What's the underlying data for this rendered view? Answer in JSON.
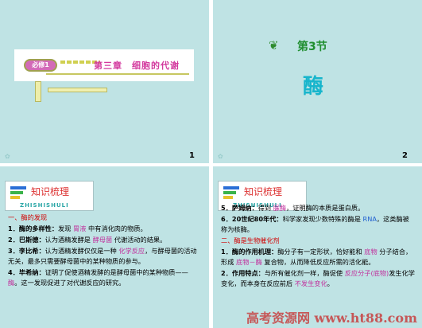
{
  "slide1": {
    "badge": "必修1",
    "chapter_title": "第三章　细胞的代谢",
    "page_number": "1"
  },
  "slide2": {
    "section_label": "第3节",
    "title": "酶",
    "page_number": "2"
  },
  "slide3": {
    "header": {
      "title": "知识梳理",
      "pinyin": "ZHISHISHULI"
    },
    "heading1": "一、酶的发现",
    "items": [
      {
        "lead": "1．酶的多样性：",
        "text": "发现",
        "hl": "胃液",
        "tail": "中有消化肉的物质。"
      },
      {
        "lead": "2．巴斯德：",
        "text": "认为酒精发酵是",
        "hl": "酵母菌",
        "tail": "代谢活动的结果。"
      },
      {
        "lead": "3．李比希：",
        "text": "认为酒精发酵仅仅是一种",
        "hl": "化学反应",
        "tail": "，与酵母菌的活动无关，最多只需要酵母菌中的某种物质的参与。"
      },
      {
        "lead": "4．毕希纳：",
        "text": "证明了促使酒精发酵的是酵母菌中的某种物质——",
        "hl": "酶",
        "tail": "。这一发现促进了对代谢反应的研究。"
      }
    ]
  },
  "slide4": {
    "header": {
      "title": "知识梳理",
      "pinyin": "ZHISHISHULI"
    },
    "items": [
      {
        "lead": "5．萨姆纳：",
        "text": "得到",
        "hl": "脲酶",
        "tail": "，证明酶的本质是蛋白质。"
      },
      {
        "lead": "6．20世纪80年代：",
        "text": "科学家发现少数特殊的酶是",
        "hl": "RNA",
        "tail": "，这类酶被称为核酶。"
      }
    ],
    "heading2": "二、酶是生物催化剂",
    "items2": [
      {
        "lead": "1．酶的作用机理：",
        "text": "酶分子有一定形状，恰好能和",
        "hl": "底物",
        "tail": "分子结合，形成",
        "hl2": "底物－酶",
        "tail2": "复合物，从而降低反应所需的活化能。"
      },
      {
        "lead": "2．作用特点：",
        "text": "与所有催化剂一样，酶促使",
        "hl": "反应分子(底物)",
        "tail": "发生化学变化，而本身在反应前后",
        "hl2": "不发生变化",
        "tail2": "。"
      }
    ],
    "watermark": "高考资源网 www.ht88.com"
  }
}
